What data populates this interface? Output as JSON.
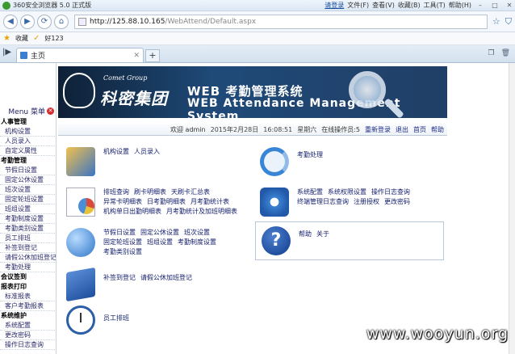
{
  "browser": {
    "title": "360安全浏览器 5.0 正式版",
    "login": "请登录",
    "menus": [
      "文件(F)",
      "查看(V)",
      "收藏(B)",
      "工具(T)",
      "帮助(H)"
    ],
    "address_host": "http://125.88.10.165",
    "address_path": "/WebAttend/Default.aspx",
    "favorites_label": "收藏",
    "favorite_link": "好123",
    "tab_title": "主页",
    "newtab_label": "+"
  },
  "left_menu": {
    "header_label": "Menu 菜单",
    "items": [
      {
        "label": "人事管理",
        "type": "group"
      },
      {
        "label": "机构设置",
        "type": "sub"
      },
      {
        "label": "人员录入",
        "type": "sub"
      },
      {
        "label": "自定义属性",
        "type": "sub"
      },
      {
        "label": "考勤管理",
        "type": "group"
      },
      {
        "label": "节假日设置",
        "type": "sub"
      },
      {
        "label": "固定公休设置",
        "type": "sub"
      },
      {
        "label": "班次设置",
        "type": "sub"
      },
      {
        "label": "固定轮班设置",
        "type": "sub"
      },
      {
        "label": "班组设置",
        "type": "sub"
      },
      {
        "label": "考勤制度设置",
        "type": "sub"
      },
      {
        "label": "考勤类别设置",
        "type": "sub"
      },
      {
        "label": "员工排班",
        "type": "sub"
      },
      {
        "label": "补签到登记",
        "type": "sub"
      },
      {
        "label": "请假公休加班登记",
        "type": "sub"
      },
      {
        "label": "考勤处理",
        "type": "sub"
      },
      {
        "label": "会议签到",
        "type": "group"
      },
      {
        "label": "报表打印",
        "type": "group"
      },
      {
        "label": "标准报表",
        "type": "sub"
      },
      {
        "label": "客户考勤报表",
        "type": "sub"
      },
      {
        "label": "系统维护",
        "type": "group"
      },
      {
        "label": "系统配置",
        "type": "sub"
      },
      {
        "label": "更改密码",
        "type": "sub"
      },
      {
        "label": "操作日志查询",
        "type": "sub"
      }
    ]
  },
  "banner": {
    "company_en": "Comet Group",
    "company_cn": "科密集团",
    "title_cn": "WEB 考勤管理系统",
    "title_en": "WEB Attendance Management System"
  },
  "infobar": {
    "welcome": "欢迎 admin",
    "date": "2015年2月28日",
    "time": "16:08:51",
    "weekday": "星期六",
    "online": "在线操作员:5",
    "relogin": "重新登录",
    "logout": "退出",
    "home": "首页",
    "help": "帮助"
  },
  "functions": {
    "org": [
      "机构设置",
      "人员录入"
    ],
    "report_row1": [
      "排班查询",
      "刷卡明细表",
      "天刷卡汇总表"
    ],
    "report_row2": [
      "异常卡明细表",
      "日考勤明细表",
      "月考勤统计表"
    ],
    "report_row3": [
      "机构单日出勤明细表",
      "月考勤统计及加班明细表"
    ],
    "settings_row1": [
      "节假日设置",
      "固定公休设置",
      "班次设置"
    ],
    "settings_row2": [
      "固定轮班设置",
      "班组设置",
      "考勤制度设置"
    ],
    "settings_row3": [
      "考勤类别设置"
    ],
    "signin": [
      "补签到登记",
      "请假公休加班登记"
    ],
    "schedule": [
      "员工排班"
    ],
    "process": [
      "考勤处理"
    ],
    "system_row1": [
      "系统配置",
      "系统权限设置",
      "操作日志查询"
    ],
    "system_row2": [
      "终端管理日志查询",
      "注册授权",
      "更改密码"
    ],
    "help": [
      "帮助",
      "关于"
    ]
  },
  "watermark": "www.wooyun.org"
}
